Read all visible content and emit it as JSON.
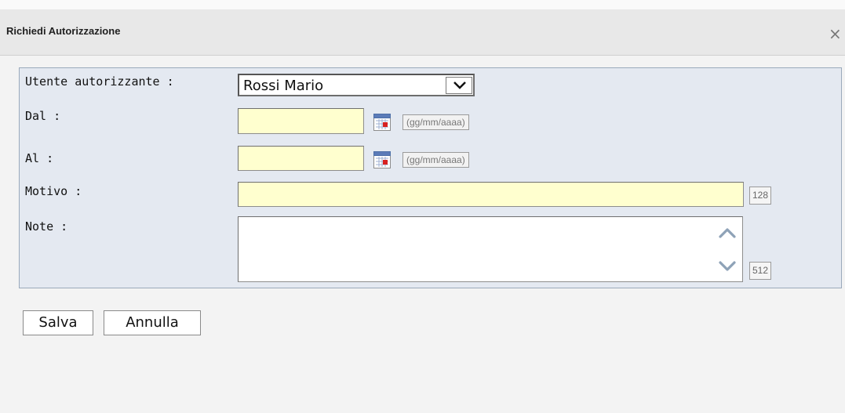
{
  "dialog": {
    "title": "Richiedi Autorizzazione",
    "close_symbol": "×"
  },
  "form": {
    "utente": {
      "label": "Utente autorizzante :",
      "value": "Rossi Mario"
    },
    "dal": {
      "label": "Dal :",
      "value": "",
      "hint": "(gg/mm/aaaa)"
    },
    "al": {
      "label": "Al :",
      "value": "",
      "hint": "(gg/mm/aaaa)"
    },
    "motivo": {
      "label": "Motivo :",
      "value": "",
      "max_chars": "128"
    },
    "note": {
      "label": "Note :",
      "value": "",
      "max_chars": "512"
    }
  },
  "actions": {
    "save": "Salva",
    "cancel": "Annulla"
  },
  "icons": {
    "calendar": "calendar-icon",
    "chevron_down": "chevron-down-icon",
    "scroll_up": "chevron-up-icon",
    "scroll_down": "chevron-down-icon",
    "close": "close-icon"
  },
  "colors": {
    "required_field_bg": "#ffffcf",
    "panel_bg": "#e4e9f1",
    "panel_border": "#9aa9bb"
  }
}
